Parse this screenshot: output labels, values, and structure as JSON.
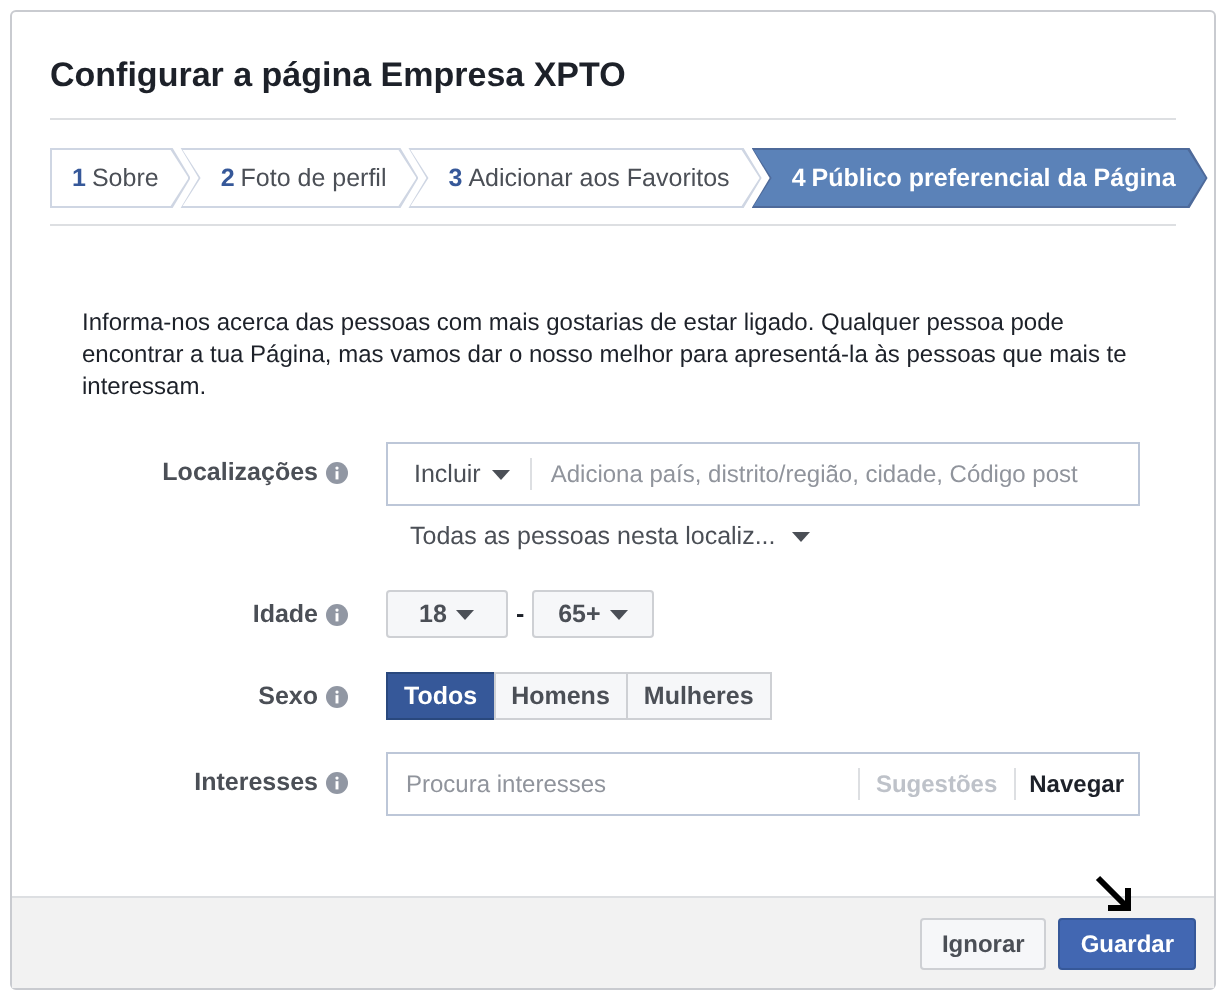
{
  "dialog": {
    "title": "Configurar a página Empresa XPTO"
  },
  "steps": [
    {
      "number": "1",
      "label": "Sobre",
      "selected": false
    },
    {
      "number": "2",
      "label": "Foto de perfil",
      "selected": false
    },
    {
      "number": "3",
      "label": "Adicionar aos Favoritos",
      "selected": false
    },
    {
      "number": "4",
      "label": "Público preferencial da Página",
      "selected": true
    }
  ],
  "intro": "Informa-nos acerca das pessoas com mais gostarias de estar ligado. Qualquer pessoa pode encontrar a tua Página, mas vamos dar o nosso melhor para apresentá-la às pessoas que mais te interessam.",
  "locations": {
    "label": "Localizações",
    "mode": "Incluir",
    "placeholder": "Adiciona país, distrito/região, cidade, Código post",
    "scope": "Todas as pessoas nesta localiz..."
  },
  "age": {
    "label": "Idade",
    "min": "18",
    "separator": "-",
    "max": "65+"
  },
  "gender": {
    "label": "Sexo",
    "options": [
      {
        "label": "Todos",
        "selected": true
      },
      {
        "label": "Homens",
        "selected": false
      },
      {
        "label": "Mulheres",
        "selected": false
      }
    ]
  },
  "interests": {
    "label": "Interesses",
    "placeholder": "Procura interesses",
    "suggestions": "Sugestões",
    "browse": "Navegar"
  },
  "buttons": [
    {
      "label": "Ignorar",
      "kind": "secondary"
    },
    {
      "label": "Guardar",
      "kind": "primary"
    }
  ]
}
